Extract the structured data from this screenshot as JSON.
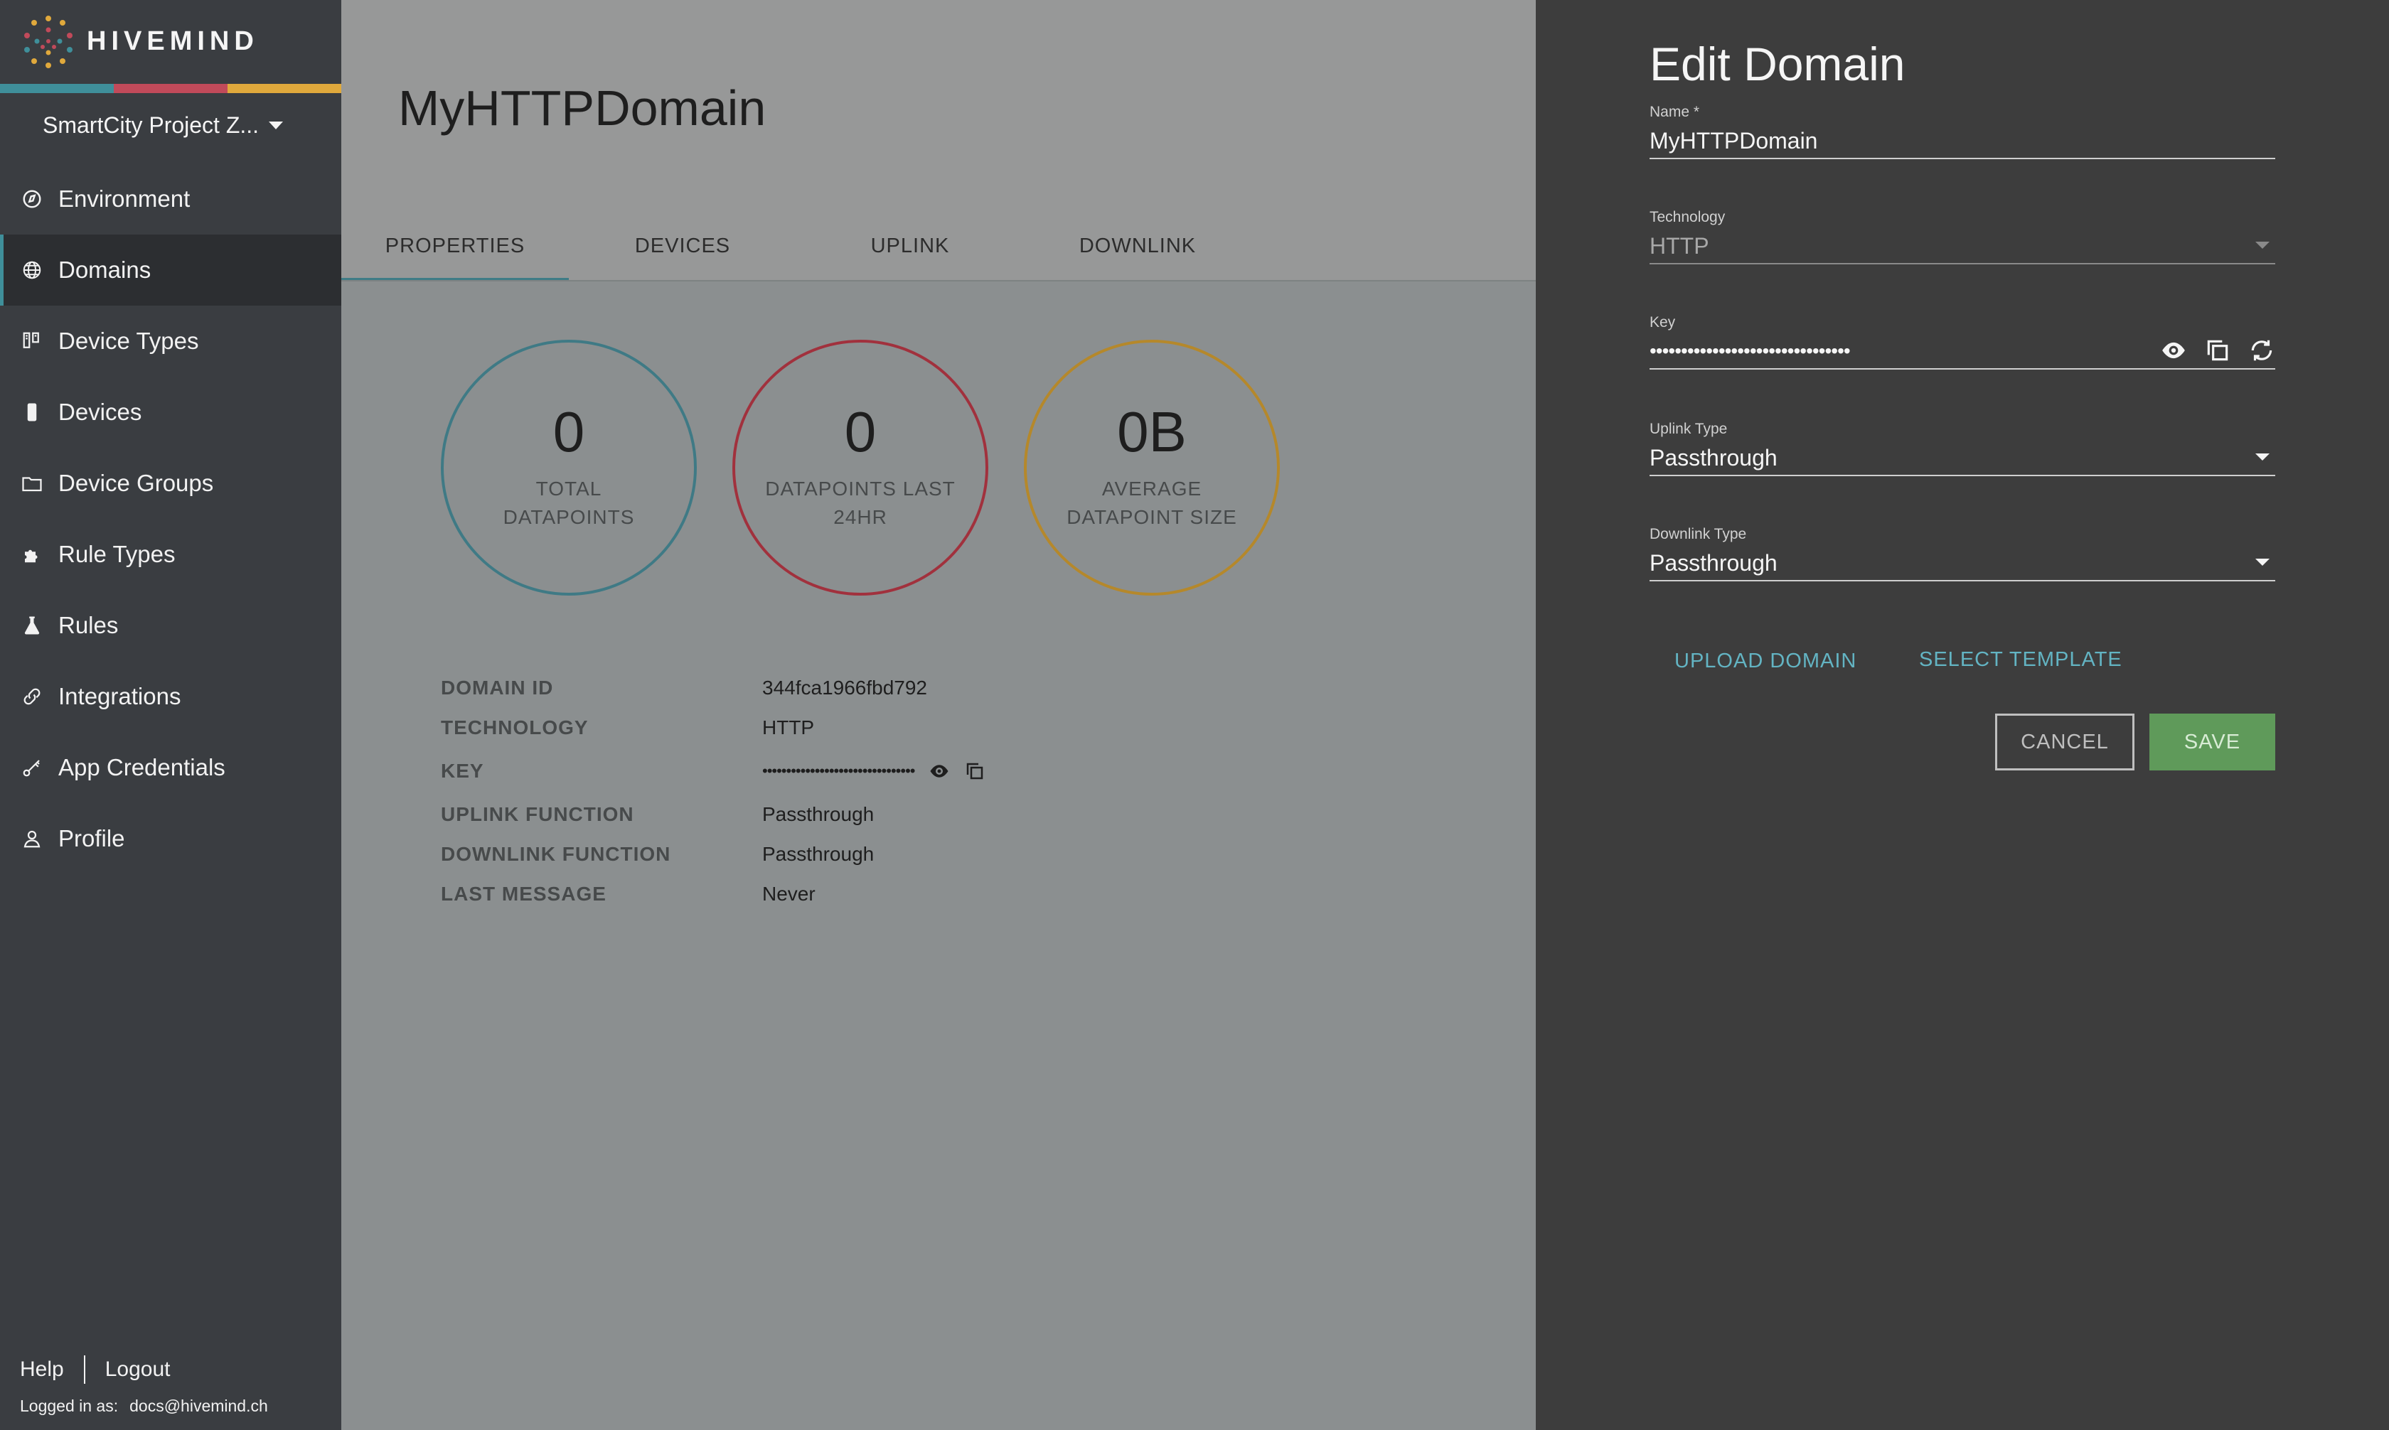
{
  "brand": {
    "name": "HIVEMIND"
  },
  "colors": {
    "accent": "#3f8f9a",
    "bar": [
      "#3f8f9a",
      "#c14a5a",
      "#e0a93c"
    ],
    "circle_total": "#3f7a85",
    "circle_24hr": "#a1313d",
    "circle_size": "#b5882b",
    "save": "#5f9a5a",
    "link": "#63b4c3"
  },
  "sidebar": {
    "project": "SmartCity Project Z...",
    "items": [
      {
        "label": "Environment",
        "icon": "environment-icon"
      },
      {
        "label": "Domains",
        "icon": "globe-icon"
      },
      {
        "label": "Device Types",
        "icon": "device-types-icon"
      },
      {
        "label": "Devices",
        "icon": "device-icon"
      },
      {
        "label": "Device Groups",
        "icon": "folder-icon"
      },
      {
        "label": "Rule Types",
        "icon": "puzzle-icon"
      },
      {
        "label": "Rules",
        "icon": "flask-icon"
      },
      {
        "label": "Integrations",
        "icon": "link-icon"
      },
      {
        "label": "App Credentials",
        "icon": "key-icon"
      },
      {
        "label": "Profile",
        "icon": "user-icon"
      }
    ],
    "footer": {
      "help": "Help",
      "logout": "Logout",
      "logged_in_label": "Logged in as:",
      "user": "docs@hivemind.ch"
    }
  },
  "main": {
    "title": "MyHTTPDomain",
    "tabs": [
      "PROPERTIES",
      "DEVICES",
      "UPLINK",
      "DOWNLINK"
    ],
    "stats": [
      {
        "value": "0",
        "label": "TOTAL DATAPOINTS"
      },
      {
        "value": "0",
        "label": "DATAPOINTS LAST 24HR"
      },
      {
        "value": "0B",
        "label": "AVERAGE DATAPOINT SIZE"
      }
    ],
    "properties": [
      {
        "label": "DOMAIN ID",
        "value": "344fca1966fbd792"
      },
      {
        "label": "TECHNOLOGY",
        "value": "HTTP"
      },
      {
        "label": "KEY",
        "value": "••••••••••••••••••••••••••••••••"
      },
      {
        "label": "UPLINK FUNCTION",
        "value": "Passthrough"
      },
      {
        "label": "DOWNLINK FUNCTION",
        "value": "Passthrough"
      },
      {
        "label": "LAST MESSAGE",
        "value": "Never"
      }
    ]
  },
  "panel": {
    "title": "Edit Domain",
    "name": {
      "label": "Name *",
      "value": "MyHTTPDomain"
    },
    "technology": {
      "label": "Technology",
      "value": "HTTP"
    },
    "key": {
      "label": "Key",
      "value": "••••••••••••••••••••••••••••••••"
    },
    "uplink": {
      "label": "Uplink Type",
      "value": "Passthrough"
    },
    "downlink": {
      "label": "Downlink Type",
      "value": "Passthrough"
    },
    "upload": "UPLOAD DOMAIN",
    "template": "SELECT TEMPLATE",
    "cancel": "CANCEL",
    "save": "SAVE"
  }
}
